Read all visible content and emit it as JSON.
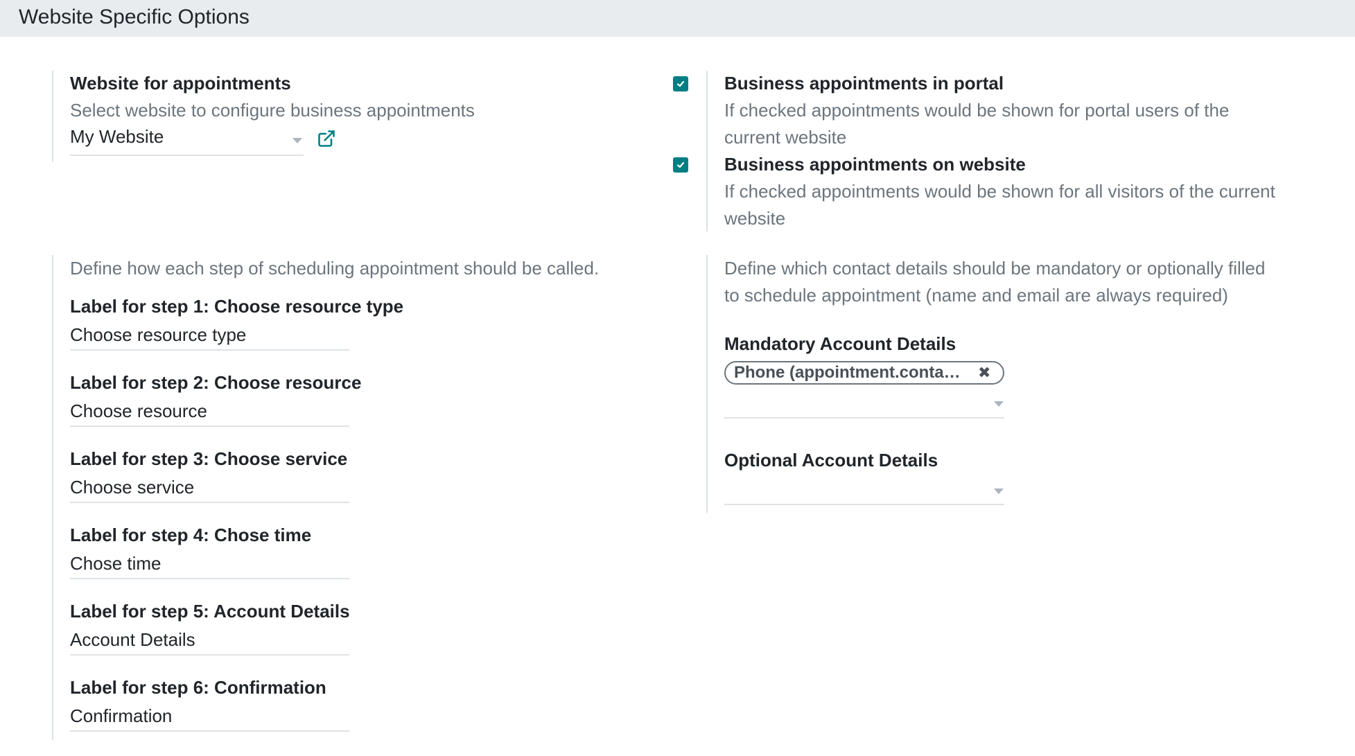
{
  "section": {
    "title": "Website Specific Options"
  },
  "website": {
    "label": "Website for appointments",
    "help": "Select website to configure business appointments",
    "value": "My Website",
    "external_link_icon": "external-link-icon"
  },
  "portal": {
    "label": "Business appointments in portal",
    "help_line1": "If checked appointments would be shown for portal users of the",
    "help_line2": "current website",
    "checked": true
  },
  "on_website": {
    "label": "Business appointments on website",
    "help_line1": "If checked appointments would be shown for all visitors of the current",
    "help_line2": "website",
    "checked": true
  },
  "steps": {
    "help": "Define how each step of scheduling appointment should be called.",
    "items": [
      {
        "label": "Label for step 1: Choose resource type",
        "value": "Choose resource type"
      },
      {
        "label": "Label for step 2: Choose resource",
        "value": "Choose resource"
      },
      {
        "label": "Label for step 3: Choose service",
        "value": "Choose service"
      },
      {
        "label": "Label for step 4: Chose time",
        "value": "Chose time"
      },
      {
        "label": "Label for step 5: Account Details",
        "value": "Account Details"
      },
      {
        "label": "Label for step 6: Confirmation",
        "value": "Confirmation"
      }
    ]
  },
  "contact": {
    "help_line1": "Define which contact details should be mandatory or optionally filled",
    "help_line2": "to schedule appointment (name and email are always required)",
    "mandatory_label": "Mandatory Account Details",
    "mandatory_tag": "Phone (appointment.contact.i...",
    "optional_label": "Optional Account Details"
  },
  "colors": {
    "accent": "#017e84",
    "header_bg": "#e9ecef",
    "muted": "#6c757d"
  }
}
